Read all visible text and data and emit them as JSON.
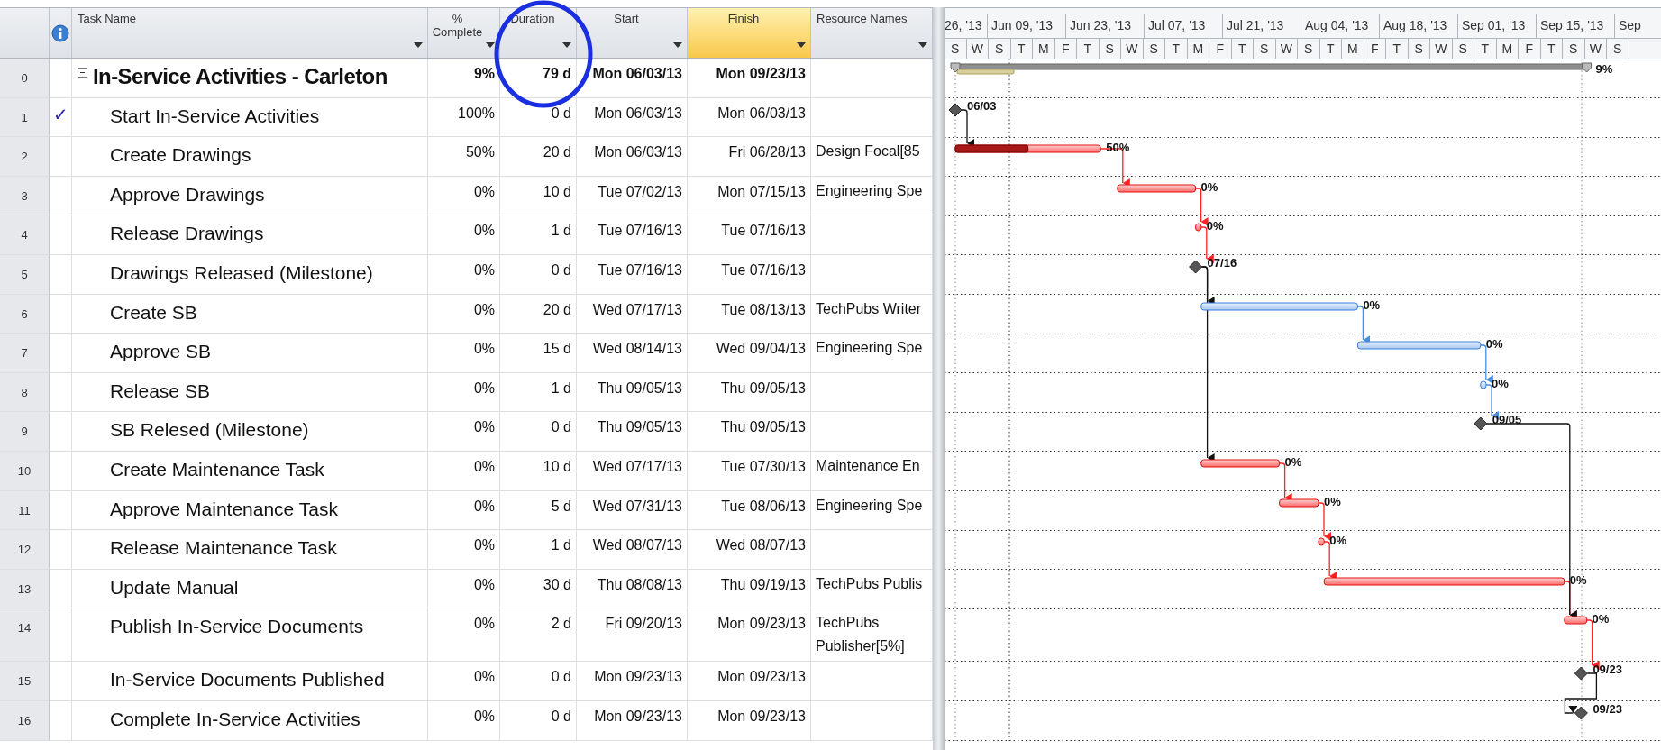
{
  "columns": [
    {
      "label": "Task Name",
      "selected": false
    },
    {
      "label": "% Complete",
      "selected": false
    },
    {
      "label": "Duration",
      "selected": false,
      "circled": true
    },
    {
      "label": "Start",
      "selected": false
    },
    {
      "label": "Finish",
      "selected": true
    },
    {
      "label": "Resource Names",
      "selected": false
    }
  ],
  "timescale": {
    "major": [
      "26, '13",
      "Jun 09, '13",
      "Jun 23, '13",
      "Jul 07, '13",
      "Jul 21, '13",
      "Aug 04, '13",
      "Aug 18, '13",
      "Sep 01, '13",
      "Sep 15, '13",
      "Sep"
    ],
    "minor": [
      "S",
      "W",
      "S",
      "T",
      "M",
      "F",
      "T",
      "S",
      "W",
      "S",
      "T",
      "M",
      "F",
      "T",
      "S",
      "W",
      "S",
      "T",
      "M",
      "F",
      "T",
      "S",
      "W",
      "S",
      "T",
      "M",
      "F",
      "T",
      "S",
      "W",
      "S"
    ]
  },
  "tasks": [
    {
      "id": "0",
      "kind": "summary",
      "expanded": true,
      "name": "In-Service Activities - Carleton",
      "complete": "9%",
      "duration": "79 d",
      "start": "Mon 06/03/13",
      "finish": "Mon 09/23/13",
      "bar_label": "9%",
      "children": [
        {
          "id": "1",
          "kind": "milestone",
          "indicator": "✓",
          "name": "Start In-Service Activities",
          "complete": "100%",
          "duration": "0 d",
          "start": "Mon 06/03/13",
          "finish": "Mon 06/03/13",
          "bar_label": "06/03"
        },
        {
          "id": "2",
          "kind": "task",
          "critical": true,
          "name": "Create Drawings",
          "complete": "50%",
          "duration": "20 d",
          "start": "Mon 06/03/13",
          "finish": "Fri 06/28/13",
          "resource": "Design Focal[85",
          "bar_label": "50%"
        },
        {
          "id": "3",
          "kind": "task",
          "critical": true,
          "name": "Approve Drawings",
          "complete": "0%",
          "duration": "10 d",
          "start": "Tue 07/02/13",
          "finish": "Mon 07/15/13",
          "resource": "Engineering Spe",
          "bar_label": "0%"
        },
        {
          "id": "4",
          "kind": "task",
          "critical": true,
          "name": "Release Drawings",
          "complete": "0%",
          "duration": "1 d",
          "start": "Tue 07/16/13",
          "finish": "Tue 07/16/13",
          "bar_label": "0%"
        },
        {
          "id": "5",
          "kind": "milestone",
          "name": "Drawings Released (Milestone)",
          "complete": "0%",
          "duration": "0 d",
          "start": "Tue 07/16/13",
          "finish": "Tue 07/16/13",
          "bar_label": "07/16"
        },
        {
          "id": "6",
          "kind": "task",
          "critical": false,
          "name": "Create SB",
          "complete": "0%",
          "duration": "20 d",
          "start": "Wed 07/17/13",
          "finish": "Tue 08/13/13",
          "resource": "TechPubs Writer",
          "bar_label": "0%"
        },
        {
          "id": "7",
          "kind": "task",
          "critical": false,
          "name": "Approve SB",
          "complete": "0%",
          "duration": "15 d",
          "start": "Wed 08/14/13",
          "finish": "Wed 09/04/13",
          "resource": "Engineering Spe",
          "bar_label": "0%"
        },
        {
          "id": "8",
          "kind": "task",
          "critical": false,
          "name": "Release SB",
          "complete": "0%",
          "duration": "1 d",
          "start": "Thu 09/05/13",
          "finish": "Thu 09/05/13",
          "bar_label": "0%"
        },
        {
          "id": "9",
          "kind": "milestone",
          "name": "SB Relesed (Milestone)",
          "complete": "0%",
          "duration": "0 d",
          "start": "Thu 09/05/13",
          "finish": "Thu 09/05/13",
          "bar_label": "09/05"
        },
        {
          "id": "10",
          "kind": "task",
          "critical": true,
          "name": "Create Maintenance Task",
          "complete": "0%",
          "duration": "10 d",
          "start": "Wed 07/17/13",
          "finish": "Tue 07/30/13",
          "resource": "Maintenance En",
          "bar_label": "0%"
        },
        {
          "id": "11",
          "kind": "task",
          "critical": true,
          "name": "Approve Maintenance Task",
          "complete": "0%",
          "duration": "5 d",
          "start": "Wed 07/31/13",
          "finish": "Tue 08/06/13",
          "resource": "Engineering Spe",
          "bar_label": "0%"
        },
        {
          "id": "12",
          "kind": "task",
          "critical": true,
          "name": "Release Maintenance Task",
          "complete": "0%",
          "duration": "1 d",
          "start": "Wed 08/07/13",
          "finish": "Wed 08/07/13",
          "bar_label": "0%"
        },
        {
          "id": "13",
          "kind": "task",
          "critical": true,
          "name": "Update Manual",
          "complete": "0%",
          "duration": "30 d",
          "start": "Thu 08/08/13",
          "finish": "Thu 09/19/13",
          "resource": "TechPubs Publis",
          "bar_label": "0%"
        },
        {
          "id": "14",
          "kind": "task",
          "critical": true,
          "name": "Publish In-Service Documents",
          "complete": "0%",
          "duration": "2 d",
          "start": "Fri 09/20/13",
          "finish": "Mon 09/23/13",
          "resource": "TechPubs Publisher[5%]",
          "bar_label": "0%"
        },
        {
          "id": "15",
          "kind": "milestone",
          "name": "In-Service Documents Published",
          "complete": "0%",
          "duration": "0 d",
          "start": "Mon 09/23/13",
          "finish": "Mon 09/23/13",
          "bar_label": "09/23"
        },
        {
          "id": "16",
          "kind": "milestone",
          "name": "Complete In-Service Activities",
          "complete": "0%",
          "duration": "0 d",
          "start": "Mon 09/23/13",
          "finish": "Mon 09/23/13",
          "bar_label": "09/23"
        }
      ]
    }
  ]
}
